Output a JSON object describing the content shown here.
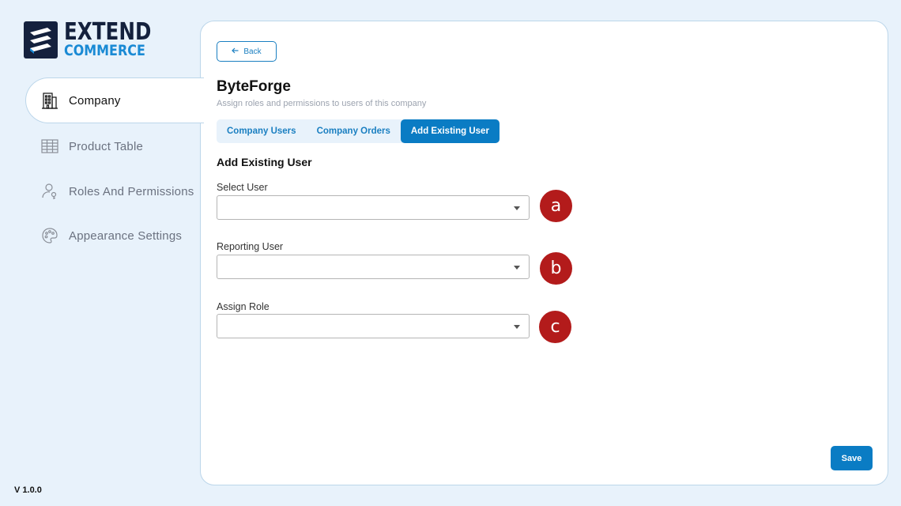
{
  "brand": {
    "line1": "EXTEND",
    "line2": "COMMERCE"
  },
  "sidebar": {
    "items": [
      {
        "label": "Company",
        "icon": "building-icon",
        "active": true
      },
      {
        "label": "Product Table",
        "icon": "table-icon",
        "active": false
      },
      {
        "label": "Roles And Permissions",
        "icon": "user-key-icon",
        "active": false
      },
      {
        "label": "Appearance Settings",
        "icon": "palette-icon",
        "active": false
      }
    ]
  },
  "version": "V 1.0.0",
  "main": {
    "back_label": "Back",
    "title": "ByteForge",
    "subtitle": "Assign roles and permissions to users of this company",
    "tabs": [
      {
        "label": "Company Users",
        "active": false
      },
      {
        "label": "Company Orders",
        "active": false
      },
      {
        "label": "Add Existing User",
        "active": true
      }
    ],
    "section_title": "Add Existing User",
    "fields": [
      {
        "label": "Select User",
        "value": "",
        "marker": "a"
      },
      {
        "label": "Reporting User",
        "value": "",
        "marker": "b"
      },
      {
        "label": "Assign Role",
        "value": "",
        "marker": "c"
      }
    ],
    "save_label": "Save"
  },
  "colors": {
    "accent": "#0a7cc4",
    "brand_dark": "#14213d",
    "marker": "#b31b1b",
    "background": "#e8f2fb"
  }
}
